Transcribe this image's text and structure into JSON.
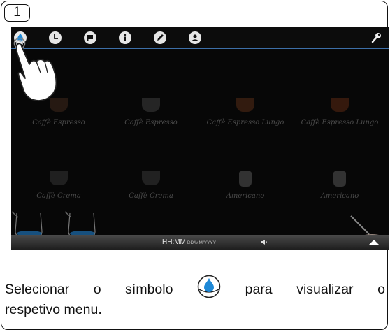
{
  "step": {
    "number": "1"
  },
  "screen": {
    "topbar_icons": [
      "water-drop-icon",
      "clock-icon",
      "flag-icon",
      "info-icon",
      "pencil-icon",
      "user-icon",
      "wrench-icon"
    ],
    "drinks": [
      {
        "label": "Caffè Espresso"
      },
      {
        "label": "Caffè Espresso"
      },
      {
        "label": "Caffè Espresso Lungo"
      },
      {
        "label": "Caffè Espresso Lungo"
      },
      {
        "label": "Caffè Crema"
      },
      {
        "label": "Caffè Crema"
      },
      {
        "label": "Americano"
      },
      {
        "label": "Americano"
      }
    ],
    "status": {
      "time": "HH:MM",
      "date": "DD/MM/YYYY"
    }
  },
  "caption": {
    "w1": "Selecionar",
    "w2": "o",
    "w3": "símbolo",
    "w4": "para",
    "w5": "visualizar",
    "w6": "o",
    "line2": "respetivo menu."
  },
  "colors": {
    "accent": "#1e88d6",
    "divider": "#3d6fa8"
  }
}
